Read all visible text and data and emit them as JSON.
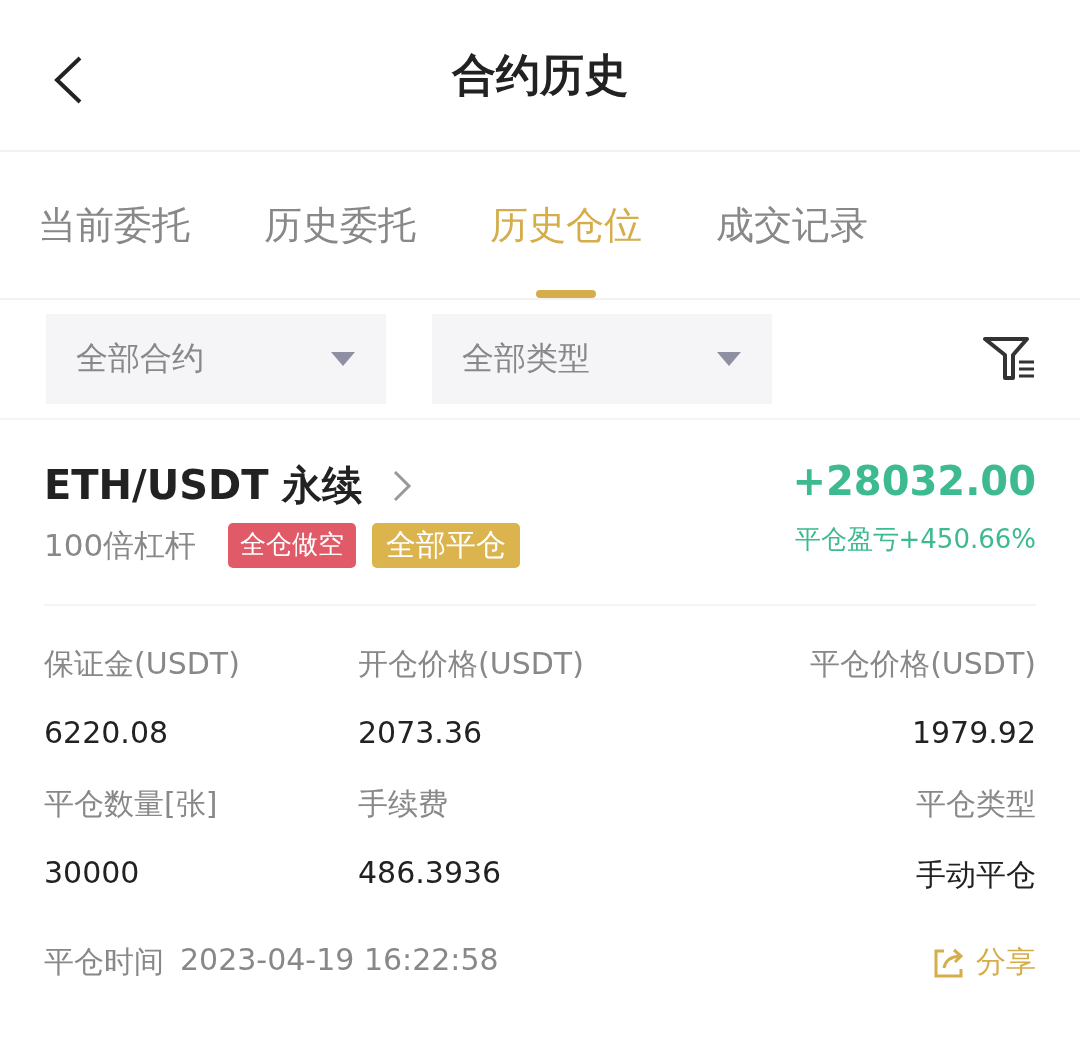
{
  "header": {
    "title": "合约历史"
  },
  "tabs": [
    {
      "label": "当前委托",
      "selected": false
    },
    {
      "label": "历史委托",
      "selected": false
    },
    {
      "label": "历史仓位",
      "selected": true
    },
    {
      "label": "成交记录",
      "selected": false
    }
  ],
  "filters": [
    {
      "label": "全部合约"
    },
    {
      "label": "全部类型"
    }
  ],
  "position": {
    "symbol": "ETH/USDT 永续",
    "leverage": "100倍杠杆",
    "tags": [
      {
        "label": "全仓做空",
        "color": "#e05a67"
      },
      {
        "label": "全部平仓",
        "color": "#dcb44e"
      }
    ],
    "pnl": "+28032.00",
    "pnl_ratio": "平仓盈亏+450.66%",
    "fields": [
      {
        "label": "保证金(USDT)",
        "value": "6220.08"
      },
      {
        "label": "开仓价格(USDT)",
        "value": "2073.36"
      },
      {
        "label": "平仓价格(USDT)",
        "value": "1979.92"
      },
      {
        "label": "平仓数量[张]",
        "value": "30000"
      },
      {
        "label": "手续费",
        "value": "486.3936"
      },
      {
        "label": "平仓类型",
        "value": "手动平仓"
      }
    ],
    "close_time_label": "平仓时间",
    "close_time": "2023-04-19 16:22:58",
    "share": "分享"
  }
}
